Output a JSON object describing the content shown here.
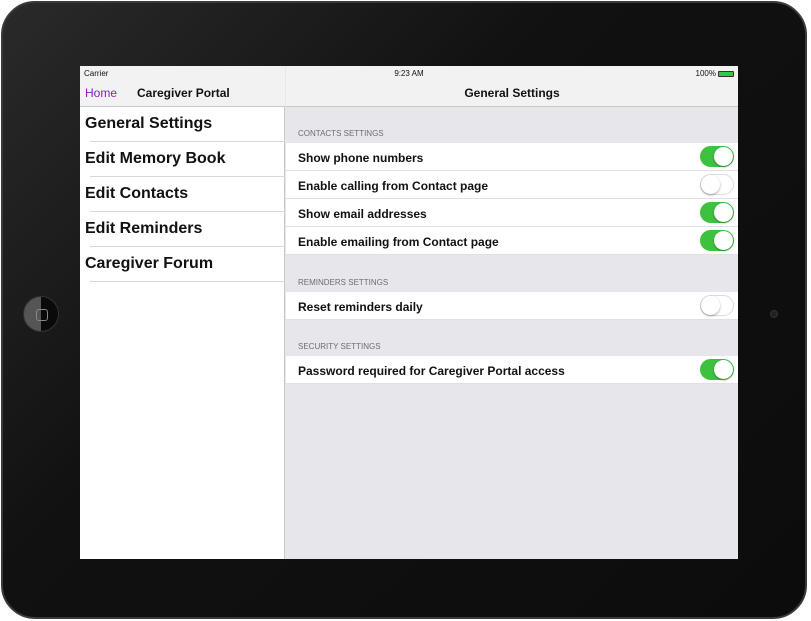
{
  "status": {
    "carrier": "Carrier",
    "time": "9:23 AM",
    "battery": "100%"
  },
  "sidebar": {
    "back": "Home",
    "title": "Caregiver Portal",
    "items": [
      {
        "label": "General Settings"
      },
      {
        "label": "Edit Memory Book"
      },
      {
        "label": "Edit Contacts"
      },
      {
        "label": "Edit Reminders"
      },
      {
        "label": "Caregiver Forum"
      }
    ]
  },
  "main": {
    "title": "General Settings",
    "sections": [
      {
        "header": "CONTACTS SETTINGS",
        "rows": [
          {
            "label": "Show phone numbers",
            "on": true
          },
          {
            "label": "Enable calling from Contact page",
            "on": false
          },
          {
            "label": "Show email addresses",
            "on": true
          },
          {
            "label": "Enable emailing from Contact page",
            "on": true
          }
        ]
      },
      {
        "header": "REMINDERS SETTINGS",
        "rows": [
          {
            "label": "Reset reminders daily",
            "on": false
          }
        ]
      },
      {
        "header": "SECURITY SETTINGS",
        "rows": [
          {
            "label": "Password required for Caregiver Portal access",
            "on": true
          }
        ]
      }
    ]
  },
  "colors": {
    "accent": "#8a1fb8",
    "toggle_on": "#3ec13f"
  }
}
